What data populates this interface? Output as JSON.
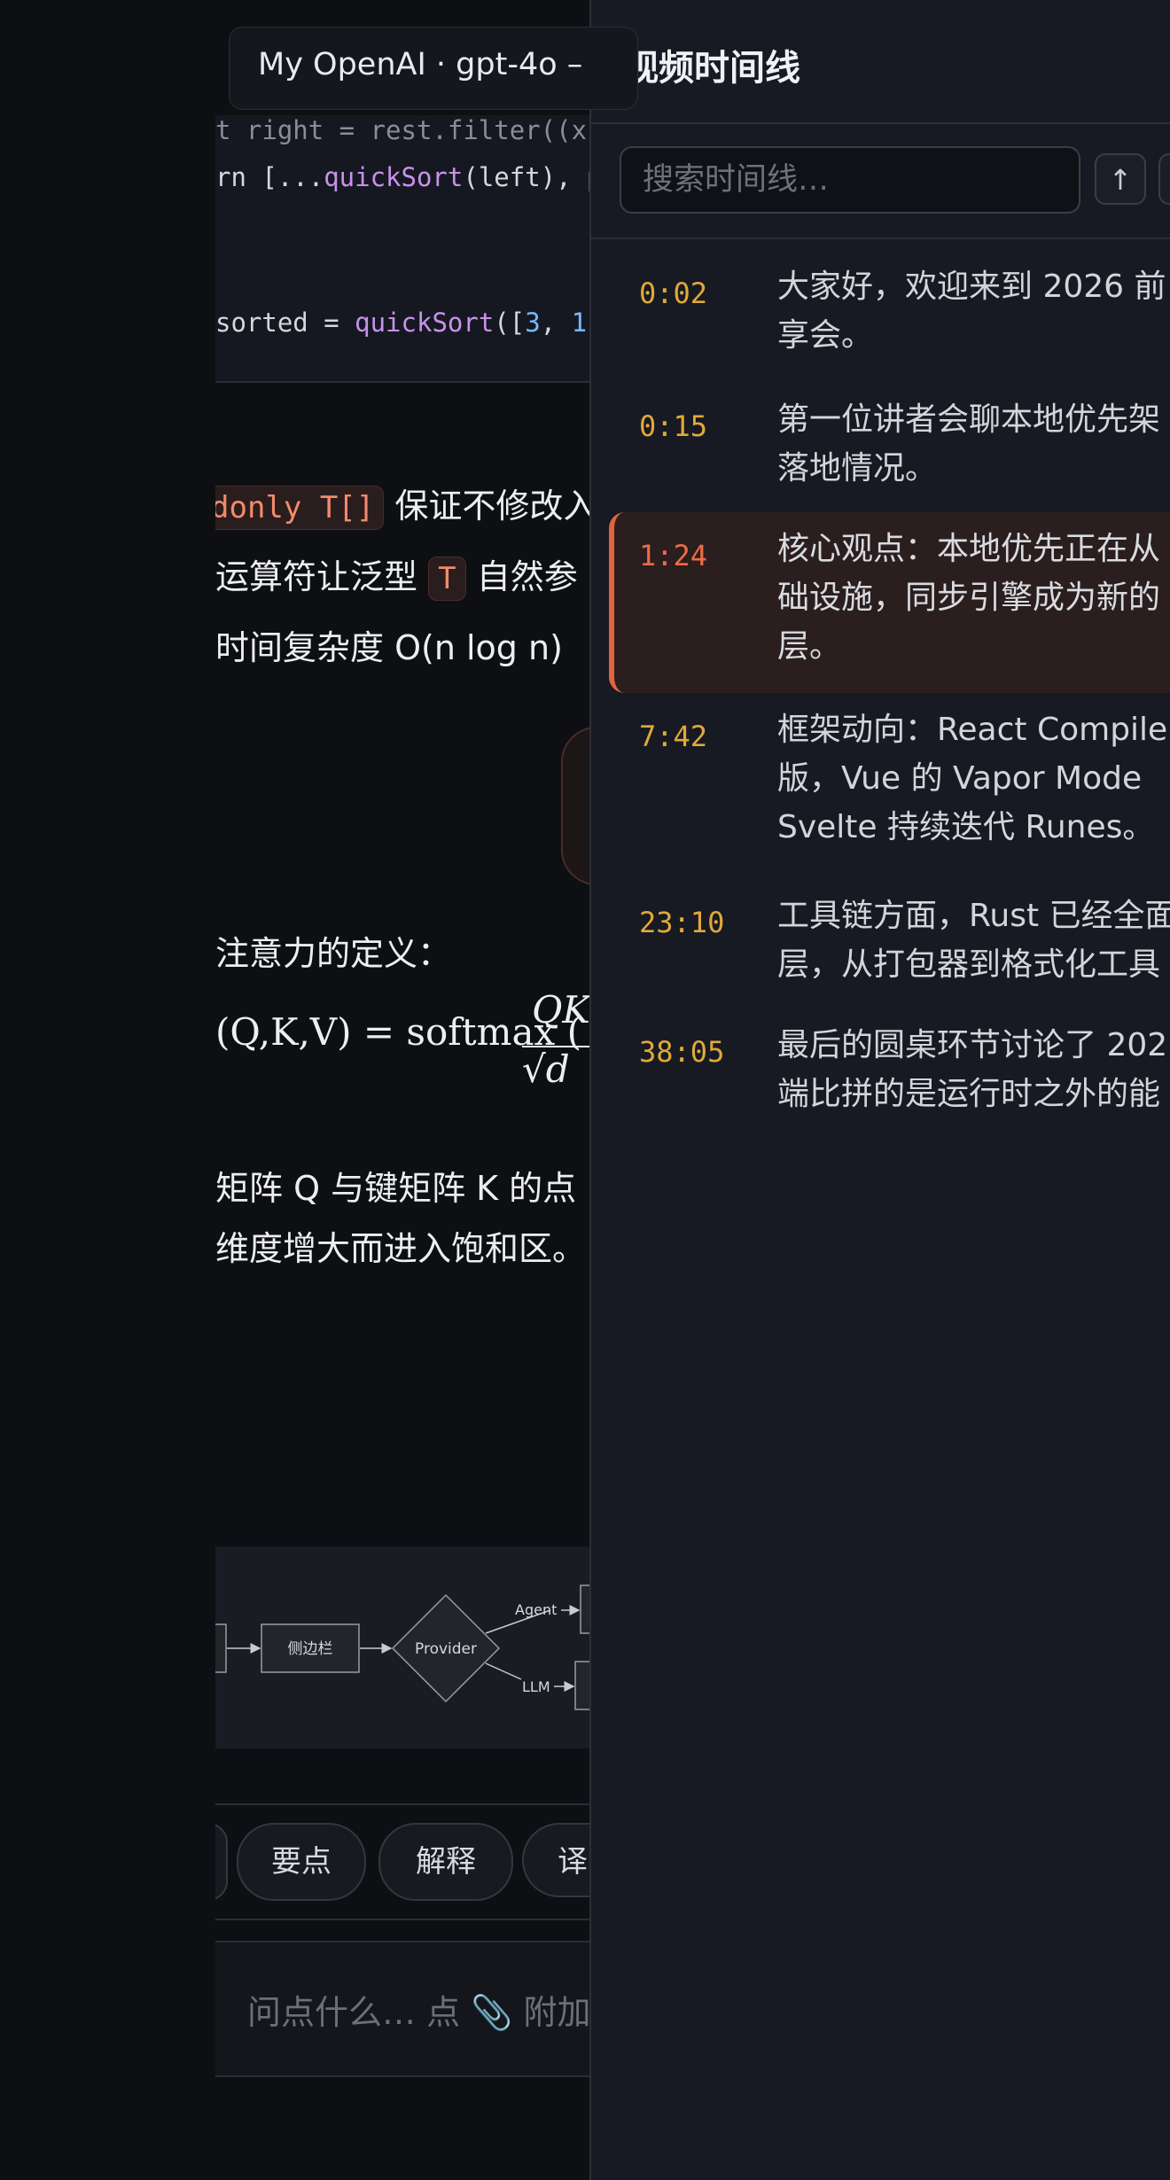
{
  "window": {
    "title": "My OpenAI · gpt-4o –"
  },
  "code": {
    "line1": "t right = rest.filter((x)",
    "line2_prefix": "rn [...",
    "line2_fn": "quickSort",
    "line2_rest": "(left), p",
    "line3_prefix": "sorted = ",
    "line3_fn": "quickSort",
    "line3_rest_a": "([",
    "line3_num1": "3",
    "line3_sep": ", ",
    "line3_num2": "1",
    "line3_rest_b": ","
  },
  "content": {
    "p1_code": "donly T[]",
    "p1_text": "保证不修改入",
    "p2_text_a": "运算符让泛型",
    "p2_code": "T",
    "p2_text_b": "自然参",
    "p3_text": "时间复杂度 O(n log n)",
    "p4_text": "注意力的定义：",
    "math_pre": "(Q,K,V) = softmax (",
    "math_num": "QK",
    "math_den": "√d",
    "p5_text": "矩阵 Q 与键矩阵 K 的点",
    "p6_text": "维度增大而进入饱和区。"
  },
  "diagram": {
    "sidebar_label": "侧边栏",
    "provider_label": "Provider",
    "agent_label": "Agent",
    "llm_label": "LLM"
  },
  "chips": {
    "chip1": "要点",
    "chip2": "解释",
    "chip3": "译"
  },
  "composer": {
    "placeholder": "问点什么… 点 📎 附加"
  },
  "timeline": {
    "title": "视频时间线",
    "search_placeholder": "搜索时间线…",
    "up_icon": "↑",
    "entries": [
      {
        "time": "0:02",
        "text": "大家好，欢迎来到 2026 前\n享会。"
      },
      {
        "time": "0:15",
        "text": "第一位讲者会聊本地优先架\n落地情况。"
      },
      {
        "time": "1:24",
        "text": "核心观点：本地优先正在从\n础设施，同步引擎成为新的\n层。"
      },
      {
        "time": "7:42",
        "text": "框架动向：React Compile\n版，Vue 的 Vapor Mode \nSvelte 持续迭代 Runes。"
      },
      {
        "time": "23:10",
        "text": "工具链方面，Rust 已经全面\n层，从打包器到格式化工具"
      },
      {
        "time": "38:05",
        "text": "最后的圆桌环节讨论了 202\n端比拼的是运行时之外的能"
      }
    ]
  },
  "colors": {
    "accent": "#e0643e",
    "timestamp": "#e0a93a",
    "panel_bg": "#171a22"
  }
}
